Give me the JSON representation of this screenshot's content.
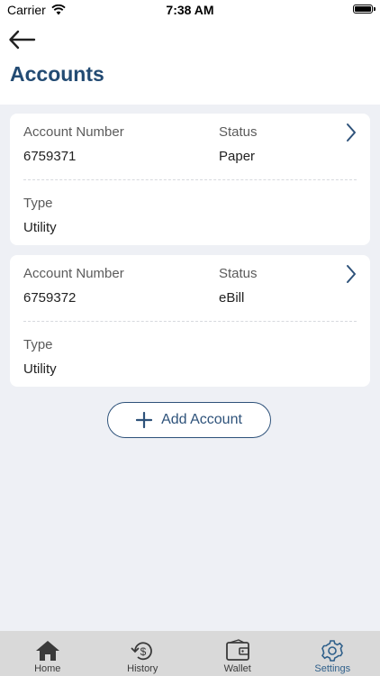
{
  "status_bar": {
    "carrier": "Carrier",
    "time": "7:38 AM"
  },
  "header": {
    "title": "Accounts"
  },
  "accounts": [
    {
      "account_number_label": "Account Number",
      "account_number": "6759371",
      "status_label": "Status",
      "status": "Paper",
      "type_label": "Type",
      "type": "Utility"
    },
    {
      "account_number_label": "Account Number",
      "account_number": "6759372",
      "status_label": "Status",
      "status": "eBill",
      "type_label": "Type",
      "type": "Utility"
    }
  ],
  "add_account": {
    "label": "Add Account"
  },
  "tabbar": {
    "active": "Settings",
    "tabs": [
      {
        "label": "Home",
        "icon": "home-icon"
      },
      {
        "label": "History",
        "icon": "history-dollar-icon"
      },
      {
        "label": "Wallet",
        "icon": "wallet-icon"
      },
      {
        "label": "Settings",
        "icon": "gear-icon"
      }
    ]
  },
  "colors": {
    "accent": "#234b73",
    "background": "#eef0f5",
    "tabbar": "#d9d9d9"
  }
}
